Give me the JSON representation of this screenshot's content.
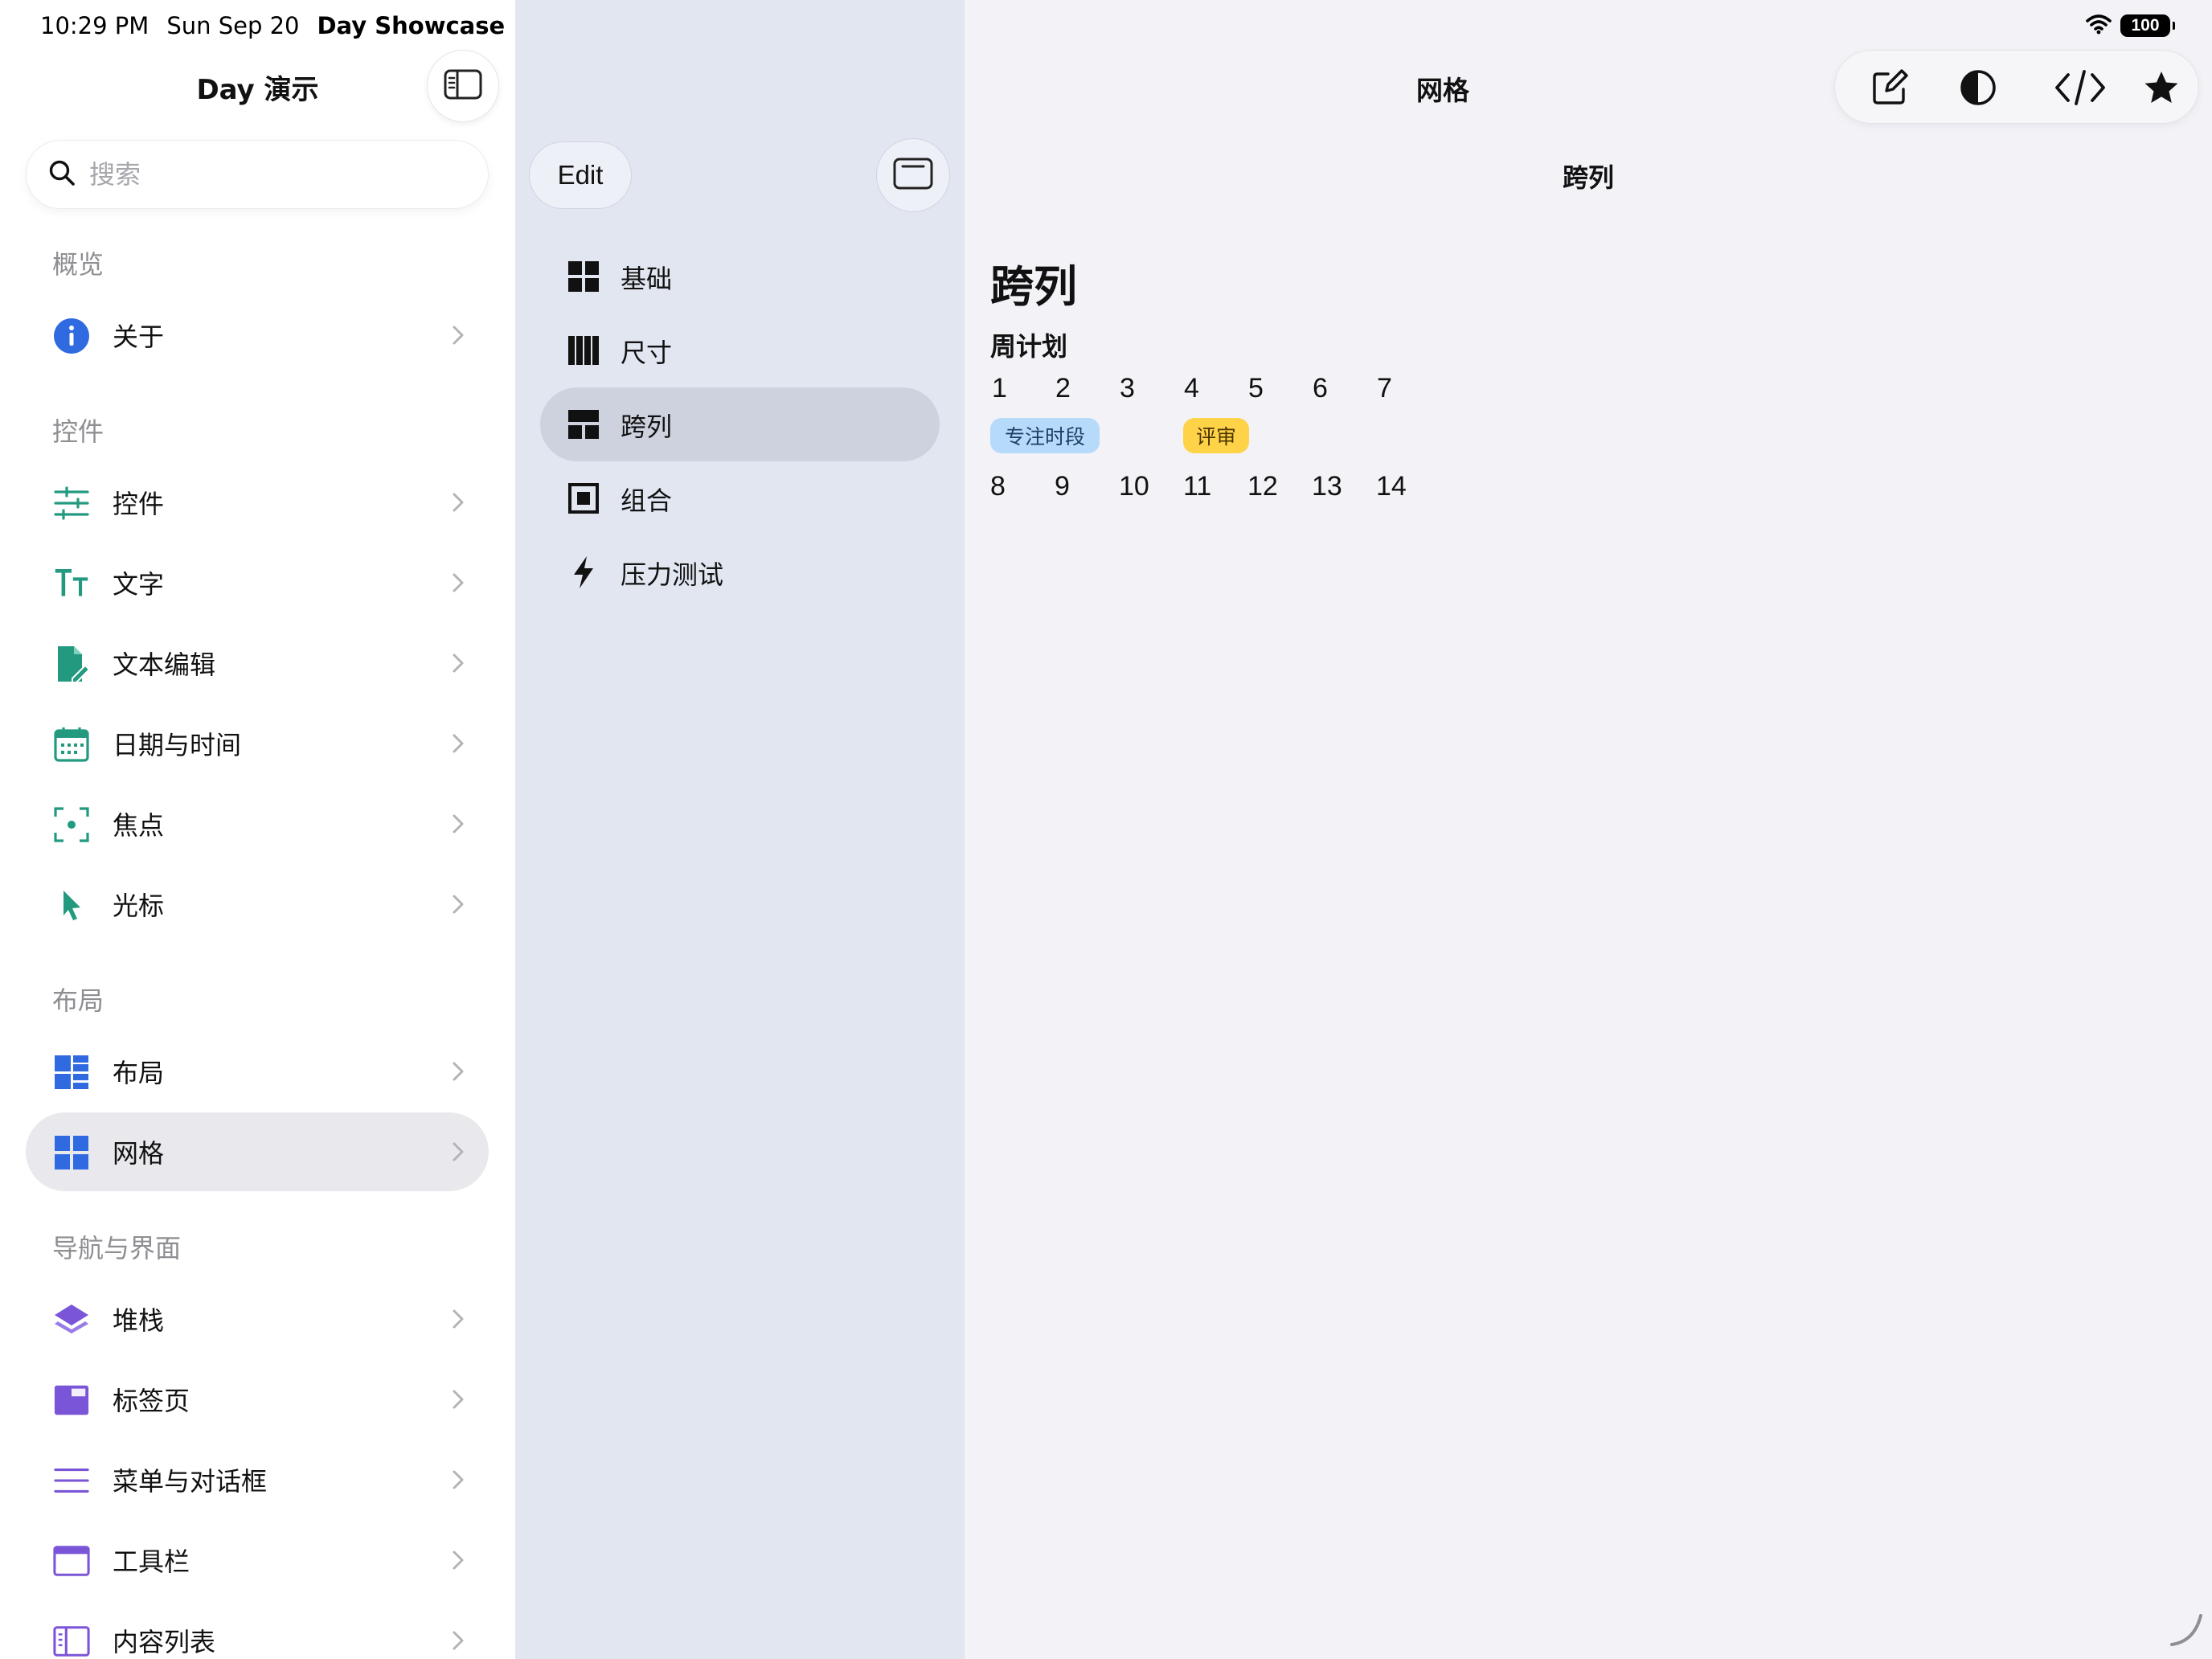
{
  "status_bar": {
    "time": "10:29 PM",
    "date": "Sun Sep 20",
    "app_name": "Day Showcase",
    "battery": "100"
  },
  "sidebar": {
    "title": "Day 演示",
    "search_placeholder": "搜索",
    "sections": [
      {
        "header": "概览",
        "items": [
          {
            "label": "关于",
            "icon": "info-icon",
            "color": "#2f6ae0"
          }
        ]
      },
      {
        "header": "控件",
        "items": [
          {
            "label": "控件",
            "icon": "sliders-icon",
            "color": "#239a7f"
          },
          {
            "label": "文字",
            "icon": "text-size-icon",
            "color": "#239a7f"
          },
          {
            "label": "文本编辑",
            "icon": "document-edit-icon",
            "color": "#239a7f"
          },
          {
            "label": "日期与时间",
            "icon": "calendar-icon",
            "color": "#239a7f"
          },
          {
            "label": "焦点",
            "icon": "focus-icon",
            "color": "#239a7f"
          },
          {
            "label": "光标",
            "icon": "cursor-icon",
            "color": "#239a7f"
          }
        ]
      },
      {
        "header": "布局",
        "items": [
          {
            "label": "布局",
            "icon": "layout-icon",
            "color": "#2f6ae0"
          },
          {
            "label": "网格",
            "icon": "grid-icon",
            "color": "#2f6ae0",
            "selected": true
          }
        ]
      },
      {
        "header": "导航与界面",
        "items": [
          {
            "label": "堆栈",
            "icon": "stack-icon",
            "color": "#7b55d8"
          },
          {
            "label": "标签页",
            "icon": "tabs-icon",
            "color": "#7b55d8"
          },
          {
            "label": "菜单与对话框",
            "icon": "menu-icon",
            "color": "#7b55d8"
          },
          {
            "label": "工具栏",
            "icon": "toolbar-icon",
            "color": "#7b55d8"
          },
          {
            "label": "内容列表",
            "icon": "content-list-icon",
            "color": "#7b55d8"
          }
        ]
      }
    ]
  },
  "middle": {
    "edit_label": "Edit",
    "items": [
      {
        "label": "基础",
        "icon": "grid-basic-icon"
      },
      {
        "label": "尺寸",
        "icon": "columns-icon"
      },
      {
        "label": "跨列",
        "icon": "span-columns-icon",
        "selected": true
      },
      {
        "label": "组合",
        "icon": "composite-icon"
      },
      {
        "label": "压力测试",
        "icon": "bolt-icon"
      }
    ]
  },
  "detail": {
    "nav_title": "网格",
    "toolbar": [
      "compose-icon",
      "contrast-icon",
      "code-icon",
      "star-icon"
    ],
    "sub_title": "跨列",
    "large_title": "跨列",
    "section_label": "周计划",
    "week1": [
      "1",
      "2",
      "3",
      "4",
      "5",
      "6",
      "7"
    ],
    "events": [
      {
        "label": "专注时段",
        "color": "#b6dafa"
      },
      {
        "label": "评审",
        "color": "#ffd348"
      }
    ],
    "week2": [
      "8",
      "9",
      "10",
      "11",
      "12",
      "13",
      "14"
    ]
  }
}
